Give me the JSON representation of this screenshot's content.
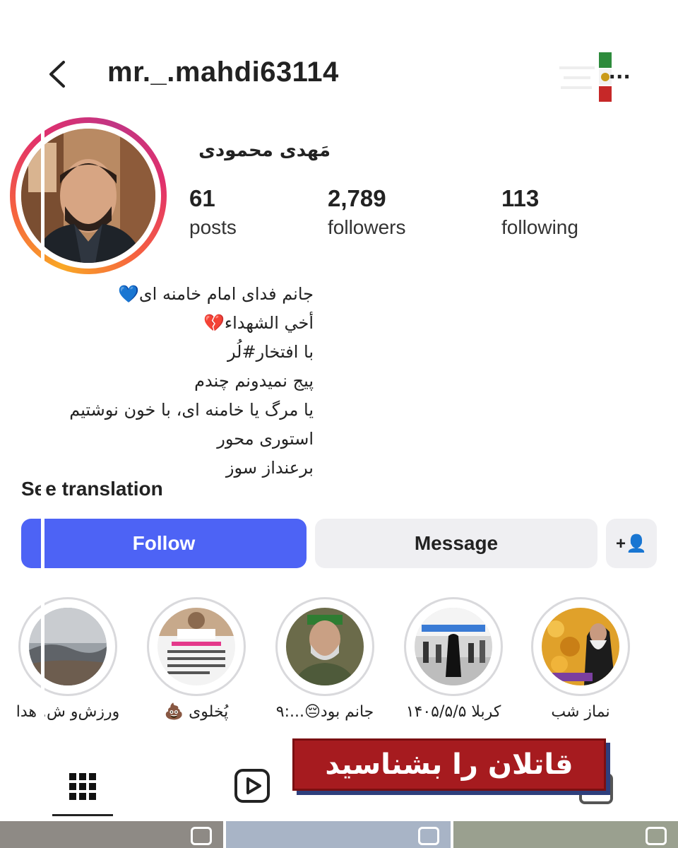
{
  "header": {
    "username": "mr._.mahdi63114",
    "more_label": "..."
  },
  "profile": {
    "full_name": "مَهدی محمودی",
    "stats": [
      {
        "value": "61",
        "label": "posts"
      },
      {
        "value": "2,789",
        "label": "followers"
      },
      {
        "value": "113",
        "label": "following"
      }
    ],
    "bio": [
      "جانم فدای امام خامنه ای💙",
      "أخي الشهداء💔",
      "با افتخار#لُر",
      "پیج نمیدونم چندم",
      "یا مرگ یا خامنه ای، با خون نوشتیم",
      "استوری محور",
      "برعنداز سوز"
    ],
    "see_translation": "See translation"
  },
  "actions": {
    "follow": "Follow",
    "message": "Message",
    "add_user": "+👤"
  },
  "highlights": [
    {
      "label": "ورزش‌و ش. هدا"
    },
    {
      "label": "پُخلوی 💩"
    },
    {
      "label": "جانم بود😔...:۹"
    },
    {
      "label": "کربلا ۱۴۰۵/۵/۵"
    },
    {
      "label": "نماز شب"
    }
  ],
  "tabs": [
    {
      "name": "grid",
      "icon": "grid-icon"
    },
    {
      "name": "reels",
      "icon": "reels-icon"
    },
    {
      "name": "tagged",
      "icon": "tagged-icon"
    }
  ],
  "banner": {
    "text": "قاتلان را بشناسید",
    "color": "#a61b1f"
  },
  "colors": {
    "follow_button": "#4d63f5",
    "message_button": "#efeff2",
    "story_ring": "#e1306c"
  }
}
